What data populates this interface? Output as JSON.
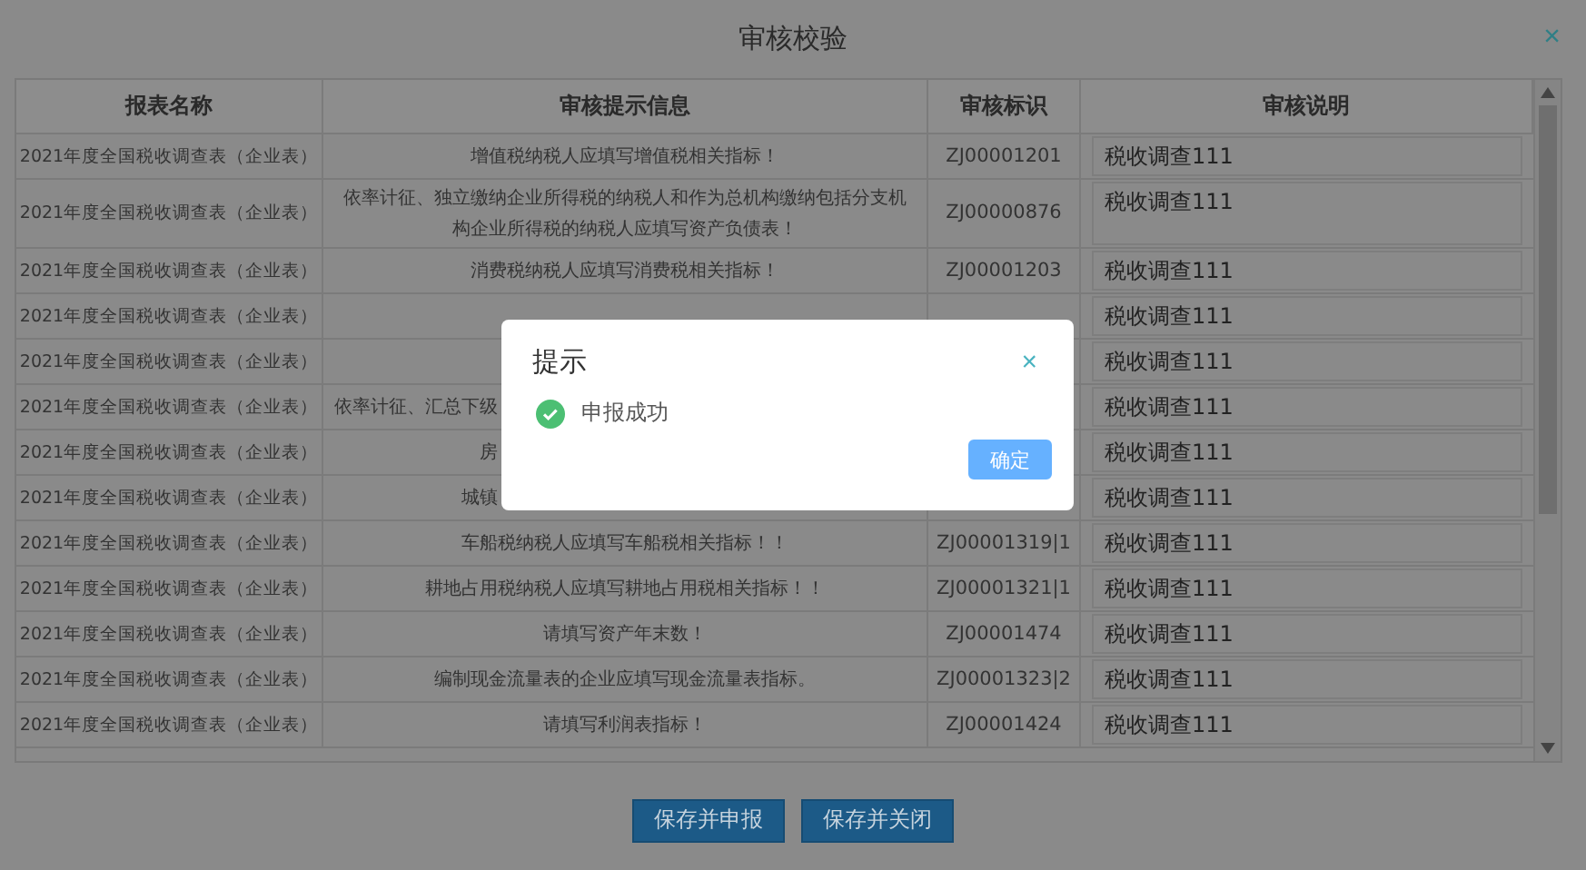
{
  "window": {
    "title": "审核校验",
    "close": "×"
  },
  "table": {
    "columns": [
      "报表名称",
      "审核提示信息",
      "审核标识",
      "审核说明"
    ],
    "rows": [
      {
        "kind": "full",
        "report": "2021年度全国税收调查表（企业表）",
        "info": "增值税纳税人应填写增值税相关指标！",
        "code": "ZJ00001201",
        "remark": "税收调查111"
      },
      {
        "kind": "full",
        "report": "2021年度全国税收调查表（企业表）",
        "info": "依率计征、独立缴纳企业所得税的纳税人和作为总机构缴纳包括分支机构企业所得税的纳税人应填写资产负债表！",
        "code": "ZJ00000876",
        "remark": "税收调查111"
      },
      {
        "kind": "full",
        "report": "2021年度全国税收调查表（企业表）",
        "info": "消费税纳税人应填写消费税相关指标！",
        "code": "ZJ00001203",
        "remark": "税收调查111"
      },
      {
        "kind": "covered",
        "report": "2021年度全国税收调查表（企业表）",
        "remark": "税收调查111"
      },
      {
        "kind": "covered",
        "report": "2021年度全国税收调查表（企业表）",
        "remark": "税收调查111"
      },
      {
        "kind": "covered",
        "report": "2021年度全国税收调查表（企业表）",
        "info": "依率计征、汇总下级",
        "remark": "税收调查111"
      },
      {
        "kind": "covered",
        "report": "2021年度全国税收调查表（企业表）",
        "info": "房",
        "remark": "税收调查111"
      },
      {
        "kind": "covered",
        "report": "2021年度全国税收调查表（企业表）",
        "info": "城镇",
        "remark": "税收调查111"
      },
      {
        "kind": "full",
        "report": "2021年度全国税收调查表（企业表）",
        "info": "车船税纳税人应填写车船税相关指标！！",
        "code": "ZJ00001319|1",
        "remark": "税收调查111"
      },
      {
        "kind": "full",
        "report": "2021年度全国税收调查表（企业表）",
        "info": "耕地占用税纳税人应填写耕地占用税相关指标！！",
        "code": "ZJ00001321|1",
        "remark": "税收调查111"
      },
      {
        "kind": "full",
        "report": "2021年度全国税收调查表（企业表）",
        "info": "请填写资产年末数！",
        "code": "ZJ00001474",
        "remark": "税收调查111"
      },
      {
        "kind": "full",
        "report": "2021年度全国税收调查表（企业表）",
        "info": "编制现金流量表的企业应填写现金流量表指标。",
        "code": "ZJ00001323|2",
        "remark": "税收调查111"
      },
      {
        "kind": "full",
        "report": "2021年度全国税收调查表（企业表）",
        "info": "请填写利润表指标！",
        "code": "ZJ00001424",
        "remark": "税收调查111"
      }
    ]
  },
  "buttons": [
    "保存并申报",
    "保存并关闭"
  ],
  "modal": {
    "title": "提示",
    "close": "×",
    "kind": "success",
    "message": "申报成功",
    "confirm": "确定"
  }
}
